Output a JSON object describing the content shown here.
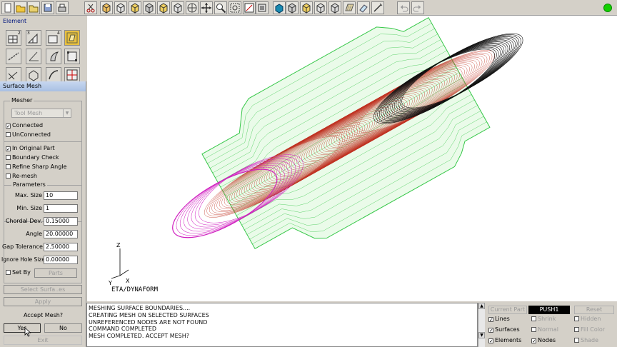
{
  "toolbar": {
    "icons": [
      "new-file-icon",
      "open-folder-icon",
      "open-file-icon",
      "save-icon",
      "print-icon",
      "cut-icon",
      "view-iso-icon",
      "view-front-icon",
      "view-back-icon",
      "view-left-icon",
      "view-right-icon",
      "view-top-icon",
      "rotate-icon",
      "pan-icon",
      "zoom-icon",
      "zoom-box-icon",
      "fit-icon",
      "select-icon",
      "shade-icon",
      "box1-icon",
      "box2-icon",
      "box3-icon",
      "box4-icon",
      "mesh-icon",
      "eraser-icon",
      "measure-icon",
      "undo-icon",
      "redo-icon"
    ]
  },
  "element_panel": {
    "title": "Element",
    "numbers": [
      "2",
      "3",
      "4"
    ]
  },
  "surface_mesh": {
    "title": "Surface Mesh",
    "mesher_group": "Mesher",
    "mesher_value": "Tool Mesh",
    "connected": "Connected",
    "unconnected": "UnConnected",
    "in_original_part": "In Original Part",
    "boundary_check": "Boundary Check",
    "refine_sharp_angle": "Refine Sharp Angle",
    "remesh": "Re-mesh",
    "parameters_group": "Parameters",
    "params": [
      {
        "label": "Max. Size",
        "value": "10"
      },
      {
        "label": "Min. Size",
        "value": "1"
      },
      {
        "label": "Chordal Dev.",
        "value": "0.15000"
      },
      {
        "label": "Angle",
        "value": "20.00000"
      },
      {
        "label": "Gap Tolerance",
        "value": "2.50000"
      },
      {
        "label": "Ignore Hole Size",
        "value": "0.00000"
      }
    ],
    "set_by": "Set By",
    "parts": "Parts",
    "select_surfaces": "Select Surfa..es",
    "apply": "Apply",
    "accept_mesh": "Accept Mesh?",
    "yes": "Yes",
    "no": "No",
    "exit": "Exit"
  },
  "viewport": {
    "watermark": "ETA/DYNAFORM",
    "axis_z": "Z",
    "axis_y": "Y",
    "axis_x": "X"
  },
  "console": {
    "lines": [
      "MESHING SURFACE BOUNDARIES....",
      "CREATING MESH ON SELECTED SURFACES",
      "UNREFERENCED NODES ARE NOT FOUND",
      "COMMAND COMPLETED",
      "MESH COMPLETED. ACCEPT MESH?"
    ]
  },
  "display_panel": {
    "current_part_label": "Current Part",
    "current_part_value": "PUSH1",
    "reset": "Reset",
    "lines": "Lines",
    "shrink": "Shrink",
    "hidden": "Hidden",
    "surfaces": "Surfaces",
    "normal": "Normal",
    "fill_color": "Fill Color",
    "elements": "Elements",
    "nodes": "Nodes",
    "shade": "Shade"
  },
  "colors": {
    "accent": "#12d000",
    "mesh_green": "#38c84a",
    "mesh_red": "#c03020",
    "mesh_black": "#111111",
    "mesh_magenta": "#d020c0"
  }
}
